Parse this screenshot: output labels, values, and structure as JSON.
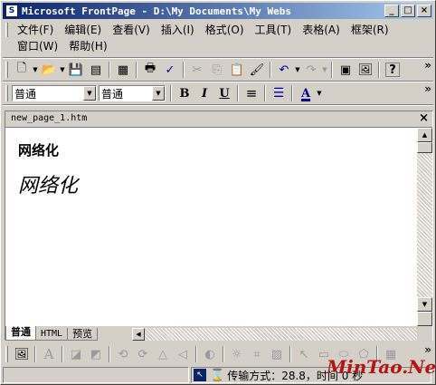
{
  "window": {
    "title": "Microsoft FrontPage - D:\\My Documents\\My Webs",
    "app_icon": "S",
    "minimize": "_",
    "maximize": "□",
    "close": "×"
  },
  "menu": {
    "row1": [
      "文件(F)",
      "编辑(E)",
      "查看(V)",
      "插入(I)",
      "格式(O)",
      "工具(T)",
      "表格(A)",
      "框架(R)"
    ],
    "row2": [
      "窗口(W)",
      "帮助(H)"
    ]
  },
  "standard_toolbar": {
    "icons": [
      "new-page-icon",
      "open-folder-icon",
      "save-icon",
      "publish-icon",
      "folder-list-icon",
      "print-icon",
      "spelling-icon",
      "cut-icon",
      "copy-icon",
      "paste-icon",
      "format-painter-icon",
      "undo-icon",
      "redo-icon",
      "insert-component-icon",
      "insert-picture-icon",
      "help-icon"
    ],
    "glyphs": {
      "new": "🗋",
      "open": "📂",
      "save": "💾",
      "publish": "▤",
      "folder": "▦",
      "print": "🖶",
      "spell": "✓",
      "cut": "✂",
      "copy": "⎘",
      "paste": "📋",
      "painter": "🖌",
      "undo": "↶",
      "redo": "↷",
      "component": "▣",
      "picture": "🖼",
      "help": "?"
    }
  },
  "format_toolbar": {
    "style_value": "普通",
    "font_value": "普通",
    "bold": "B",
    "italic": "I",
    "underline": "U",
    "center": "≡",
    "bullets": "☰",
    "font_color": "A",
    "font_color_hex": "#00008b"
  },
  "document": {
    "tab_label": "new_page_1.htm",
    "close": "×",
    "heading_bold": "网络化",
    "heading_italic": "网络化"
  },
  "view_tabs": [
    "普通",
    "HTML",
    "预览"
  ],
  "drawing_toolbar": {
    "icons": [
      "insert-picture-icon",
      "text-icon",
      "thumbnail-icon",
      "position-icon",
      "rotate-left-icon",
      "rotate-right-icon",
      "flip-vertical-icon",
      "flip-horizontal-icon",
      "bring-forward-icon",
      "contrast-icon",
      "brightness-icon",
      "crop-icon",
      "transparent-icon",
      "select-icon",
      "rectangle-icon",
      "oval-icon",
      "polygon-icon",
      "hotspot-icon"
    ]
  },
  "status": {
    "text": "传输方式：28.8，时间 0 秒",
    "icon": "↖"
  },
  "watermark": "MinTao.Net"
}
